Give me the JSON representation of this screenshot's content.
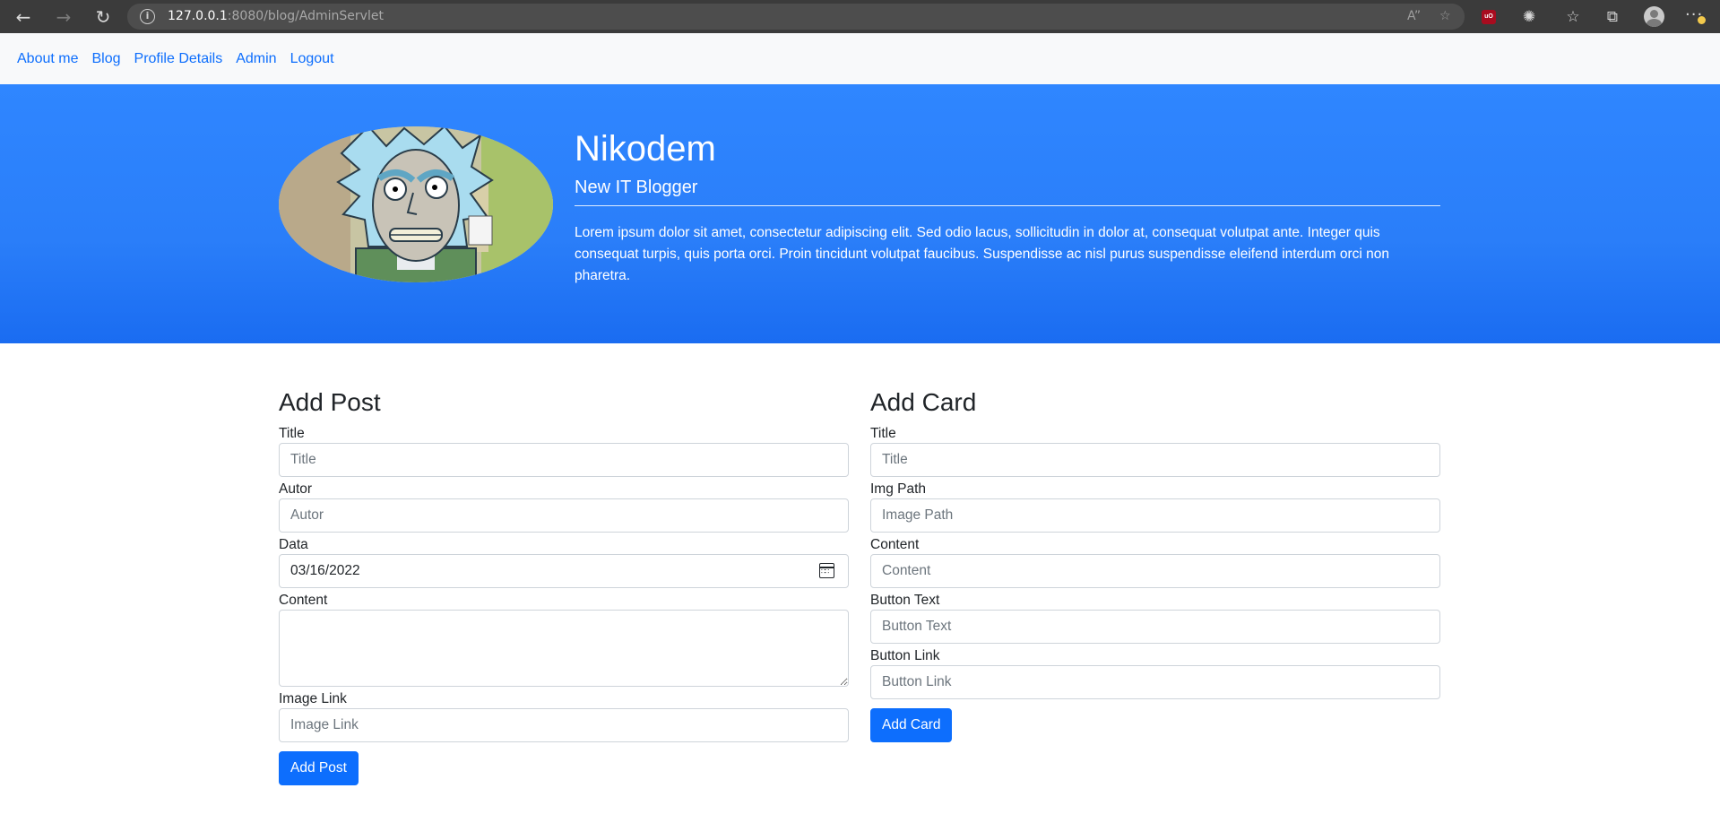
{
  "browser": {
    "url_host": "127.0.0.1",
    "url_path": ":8080/blog/AdminServlet",
    "icons": [
      "back-arrow-icon",
      "forward-arrow-icon",
      "reload-icon",
      "info-icon",
      "read-aloud-icon",
      "favorite-add-icon",
      "ublock-extension-icon",
      "extensions-icon",
      "favorites-icon",
      "collections-icon",
      "profile-avatar-icon",
      "more-menu-icon"
    ],
    "ublock_label": "uO"
  },
  "nav": {
    "items": [
      "About me",
      "Blog",
      "Profile Details",
      "Admin",
      "Logout"
    ],
    "link_color": "#0d6efd"
  },
  "hero": {
    "name": "Nikodem",
    "subtitle": "New IT Blogger",
    "text": "Lorem ipsum dolor sit amet, consectetur adipiscing elit. Sed odio lacus, sollicitudin in dolor at, consequat volutpat ante. Integer quis consequat turpis, quis porta orci. Proin tincidunt volutpat faucibus. Suspendisse ac nisl purus suspendisse eleifend interdum orci non pharetra.",
    "background_color": "#2a7ef9"
  },
  "add_post": {
    "heading": "Add Post",
    "title_label": "Title",
    "title_placeholder": "Title",
    "autor_label": "Autor",
    "autor_placeholder": "Autor",
    "data_label": "Data",
    "data_value": "03/16/2022",
    "content_label": "Content",
    "image_link_label": "Image Link",
    "image_link_placeholder": "Image Link",
    "submit_label": "Add Post"
  },
  "add_card": {
    "heading": "Add Card",
    "title_label": "Title",
    "title_placeholder": "Title",
    "img_path_label": "Img Path",
    "img_path_placeholder": "Image Path",
    "content_label": "Content",
    "content_placeholder": "Content",
    "button_text_label": "Button Text",
    "button_text_placeholder": "Button Text",
    "button_link_label": "Button Link",
    "button_link_placeholder": "Button Link",
    "submit_label": "Add Card"
  }
}
